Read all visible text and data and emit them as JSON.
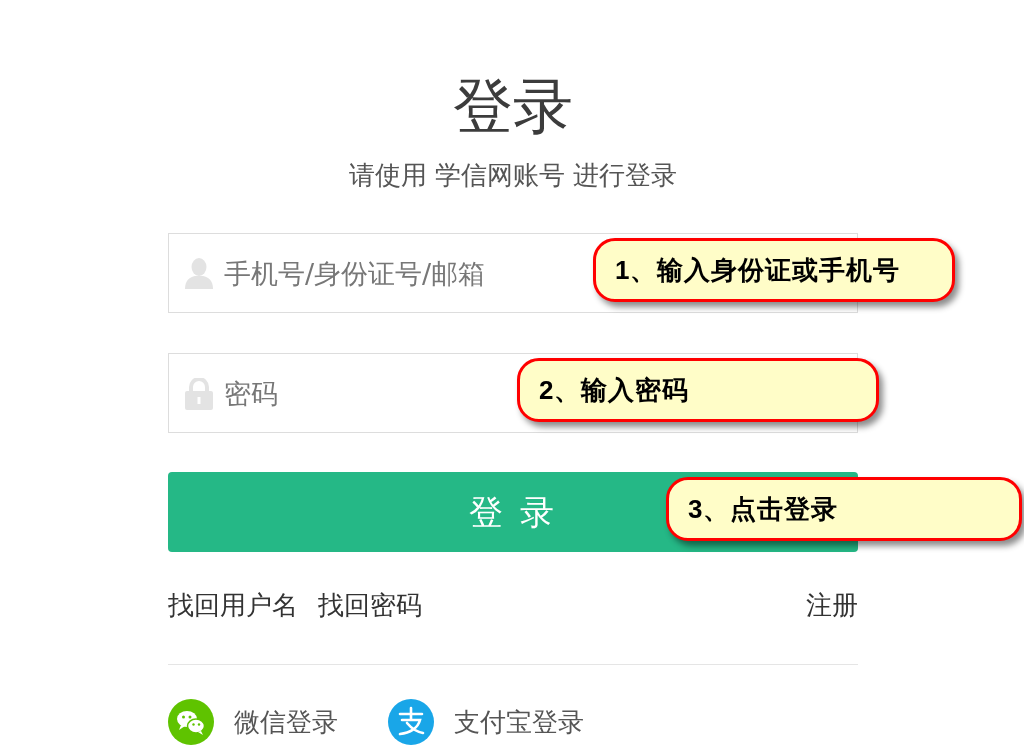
{
  "heading": {
    "title": "登录",
    "subtitle": "请使用 学信网账号 进行登录"
  },
  "form": {
    "fields": [
      {
        "kind": "account",
        "placeholder": "手机号/身份证号/邮箱"
      },
      {
        "kind": "password",
        "placeholder": "密码"
      }
    ],
    "submit": "登 录"
  },
  "links": {
    "left": [
      "找回用户名",
      "找回密码"
    ],
    "right": "注册"
  },
  "social_logins": [
    {
      "kind": "wechat",
      "label": "微信登录"
    },
    {
      "kind": "alipay",
      "label": "支付宝登录"
    }
  ],
  "callouts": [
    {
      "label": "1、输入身份证或手机号"
    },
    {
      "label": "2、输入密码"
    },
    {
      "label": "3、点击登录"
    }
  ]
}
